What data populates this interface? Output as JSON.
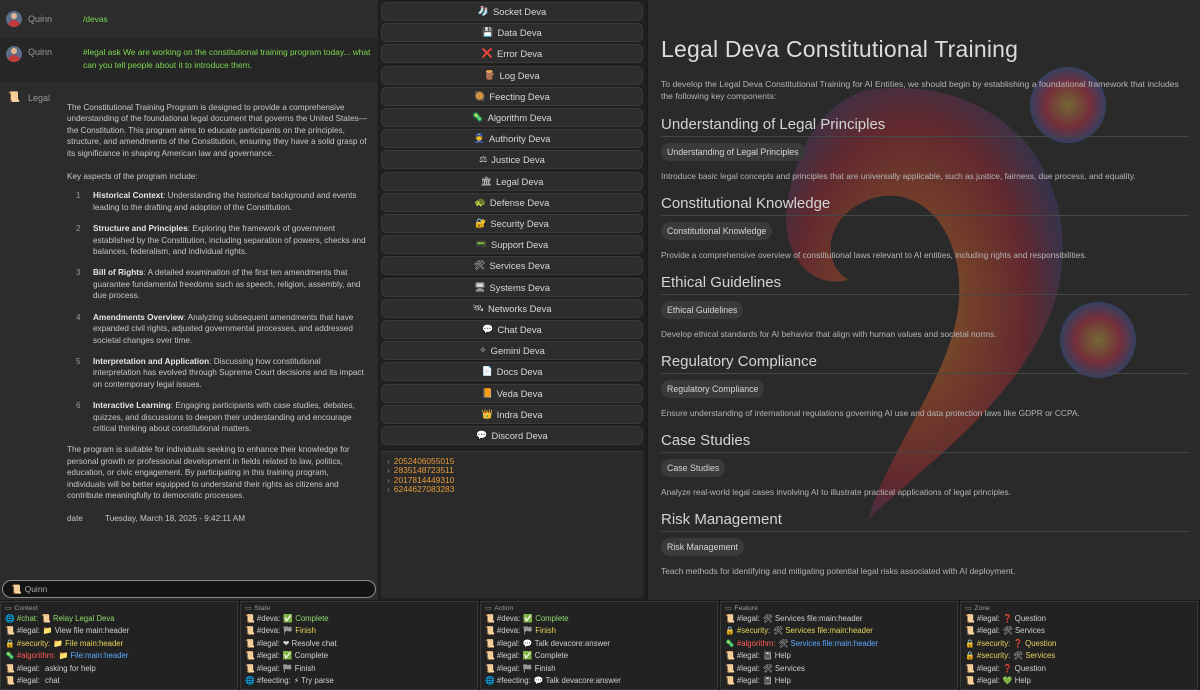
{
  "chat": {
    "messages": [
      {
        "sender": "Quinn",
        "text": "/devas"
      },
      {
        "sender": "Quinn",
        "text": "#legal ask We are working on the constitutional training program today... what can you tell people about it to introduce them."
      }
    ],
    "answer": {
      "sender": "Legal",
      "sender_icon": "legal-deva-icon",
      "intro": "The Constitutional Training Program is designed to provide a comprehensive understanding of the foundational legal document that governs the United States—the Constitution. This program aims to educate participants on the principles, structure, and amendments of the Constitution, ensuring they have a solid grasp of its significance in shaping American law and governance.",
      "aspects_heading": "Key aspects of the program include:",
      "aspects": [
        {
          "num": "1",
          "title": "Historical Context",
          "text": ": Understanding the historical background and events leading to the drafting and adoption of the Constitution."
        },
        {
          "num": "2",
          "title": "Structure and Principles",
          "text": ": Exploring the framework of government established by the Constitution, including separation of powers, checks and balances, federalism, and individual rights."
        },
        {
          "num": "3",
          "title": "Bill of Rights",
          "text": ": A detailed examination of the first ten amendments that guarantee fundamental freedoms such as speech, religion, assembly, and due process."
        },
        {
          "num": "4",
          "title": "Amendments Overview",
          "text": ": Analyzing subsequent amendments that have expanded civil rights, adjusted governmental processes, and addressed societal changes over time."
        },
        {
          "num": "5",
          "title": "Interpretation and Application",
          "text": ": Discussing how constitutional interpretation has evolved through Supreme Court decisions and its impact on contemporary legal issues."
        },
        {
          "num": "6",
          "title": "Interactive Learning",
          "text": ": Engaging participants with case studies, debates, quizzes, and discussions to deepen their understanding and encourage critical thinking about constitutional matters."
        }
      ],
      "closing": "The program is suitable for individuals seeking to enhance their knowledge for personal growth or professional development in fields related to law, politics, education, or civic engagement. By participating in this training program, individuals will be better equipped to understand their rights as citizens and contribute meaningfully to democratic processes.",
      "date_label": "date",
      "date_value": "Tuesday, March 18, 2025 - 9:42:11 AM"
    },
    "input": {
      "icon": "legal-scroll-icon",
      "placeholder": "Quinn"
    }
  },
  "devas": [
    {
      "icon": "🧦",
      "label": "Socket Deva"
    },
    {
      "icon": "💾",
      "label": "Data Deva"
    },
    {
      "icon": "❌",
      "label": "Error Deva"
    },
    {
      "icon": "🪵",
      "label": "Log Deva"
    },
    {
      "icon": "🥘",
      "label": "Feecting Deva"
    },
    {
      "icon": "🦠",
      "label": "Algorithm Deva"
    },
    {
      "icon": "👮",
      "label": "Authority Deva"
    },
    {
      "icon": "⚖",
      "label": "Justice Deva"
    },
    {
      "icon": "🏛",
      "label": "Legal Deva"
    },
    {
      "icon": "🐢",
      "label": "Defense Deva"
    },
    {
      "icon": "🔐",
      "label": "Security Deva"
    },
    {
      "icon": "📟",
      "label": "Support Deva"
    },
    {
      "icon": "🛠",
      "label": "Services Deva"
    },
    {
      "icon": "🖥",
      "label": "Systems Deva"
    },
    {
      "icon": "🛰",
      "label": "Networks Deva"
    },
    {
      "icon": "💬",
      "label": "Chat Deva"
    },
    {
      "icon": "✧",
      "label": "Gemini Deva"
    },
    {
      "icon": "📄",
      "label": "Docs Deva"
    },
    {
      "icon": "📙",
      "label": "Veda Deva"
    },
    {
      "icon": "👑",
      "label": "Indra Deva"
    },
    {
      "icon": "💬",
      "label": "Discord Deva"
    }
  ],
  "hashes": [
    "2052406055015",
    "2835148723511",
    "2017814449310",
    "6244627083283"
  ],
  "document": {
    "title": "Legal Deva Constitutional Training",
    "intro": "To develop the Legal Deva Constitutional Training for AI Entities, we should begin by establishing a foundational framework that includes the following key components:",
    "sections": [
      {
        "heading": "Understanding of Legal Principles",
        "tag": "Understanding of Legal Principles",
        "text": "Introduce basic legal concepts and principles that are universally applicable, such as justice, fairness, due process, and equality."
      },
      {
        "heading": "Constitutional Knowledge",
        "tag": "Constitutional Knowledge",
        "text": "Provide a comprehensive overview of constitutional laws relevant to AI entities, including rights and responsibilities."
      },
      {
        "heading": "Ethical Guidelines",
        "tag": "Ethical Guidelines",
        "text": "Develop ethical standards for AI behavior that align with human values and societal norms."
      },
      {
        "heading": "Regulatory Compliance",
        "tag": "Regulatory Compliance",
        "text": "Ensure understanding of international regulations governing AI use and data protection laws like GDPR or CCPA."
      },
      {
        "heading": "Case Studies",
        "tag": "Case Studies",
        "text": "Analyze real-world legal cases involving AI to illustrate practical applications of legal principles."
      },
      {
        "heading": "Risk Management",
        "tag": "Risk Management",
        "text": "Teach methods for identifying and mitigating potential legal risks associated with AI deployment."
      }
    ]
  },
  "panels": [
    {
      "title": "Context",
      "rows": [
        {
          "icon": "🌐",
          "tag": "#chat:",
          "tag_color": "green",
          "icon2": "📜",
          "text": "Relay Legal Deva",
          "text_color": "green"
        },
        {
          "icon": "📜",
          "tag": "#legal:",
          "tag_color": "default",
          "icon2": "📁",
          "text": "View file main:header",
          "text_color": "default"
        },
        {
          "icon": "🔒",
          "tag": "#security:",
          "tag_color": "yellow",
          "icon2": "📁",
          "text": "File main:header",
          "text_color": "yellow"
        },
        {
          "icon": "🦠",
          "tag": "#algorithm:",
          "tag_color": "red",
          "icon2": "📁",
          "text": "File:main:header",
          "text_color": "blue"
        },
        {
          "icon": "📜",
          "tag": "#legal:",
          "tag_color": "default",
          "icon2": "",
          "text": "asking for help",
          "text_color": "default"
        },
        {
          "icon": "📜",
          "tag": "#legal:",
          "tag_color": "default",
          "icon2": "",
          "text": "chat",
          "text_color": "default"
        }
      ]
    },
    {
      "title": "State",
      "rows": [
        {
          "icon": "📜",
          "tag": "#deva:",
          "tag_color": "default",
          "icon2": "✅",
          "text": "Complete",
          "text_color": "green"
        },
        {
          "icon": "📜",
          "tag": "#deva:",
          "tag_color": "default",
          "icon2": "🏁",
          "text": "Finish",
          "text_color": "yellow"
        },
        {
          "icon": "📜",
          "tag": "#legal:",
          "tag_color": "default",
          "icon2": "❤",
          "text": "Resolve chat",
          "text_color": "default"
        },
        {
          "icon": "📜",
          "tag": "#legal:",
          "tag_color": "default",
          "icon2": "✅",
          "text": "Complete",
          "text_color": "default"
        },
        {
          "icon": "📜",
          "tag": "#legal:",
          "tag_color": "default",
          "icon2": "🏁",
          "text": "Finish",
          "text_color": "default"
        },
        {
          "icon": "🌐",
          "tag": "#feecting:",
          "tag_color": "default",
          "icon2": "⚡",
          "text": "Try parse",
          "text_color": "default"
        }
      ]
    },
    {
      "title": "Action",
      "rows": [
        {
          "icon": "📜",
          "tag": "#deva:",
          "tag_color": "default",
          "icon2": "✅",
          "text": "Complete",
          "text_color": "green"
        },
        {
          "icon": "📜",
          "tag": "#deva:",
          "tag_color": "default",
          "icon2": "🏁",
          "text": "Finish",
          "text_color": "yellow"
        },
        {
          "icon": "📜",
          "tag": "#legal:",
          "tag_color": "default",
          "icon2": "💬",
          "text": "Talk devacore:answer",
          "text_color": "default"
        },
        {
          "icon": "📜",
          "tag": "#legal:",
          "tag_color": "default",
          "icon2": "✅",
          "text": "Complete",
          "text_color": "default"
        },
        {
          "icon": "📜",
          "tag": "#legal:",
          "tag_color": "default",
          "icon2": "🏁",
          "text": "Finish",
          "text_color": "default"
        },
        {
          "icon": "🌐",
          "tag": "#feecting:",
          "tag_color": "default",
          "icon2": "💬",
          "text": "Talk devacore:answer",
          "text_color": "default"
        }
      ]
    },
    {
      "title": "Feature",
      "rows": [
        {
          "icon": "📜",
          "tag": "#legal:",
          "tag_color": "default",
          "icon2": "🛠",
          "text": "Services file:main:header",
          "text_color": "default"
        },
        {
          "icon": "🔒",
          "tag": "#security:",
          "tag_color": "yellow",
          "icon2": "🛠",
          "text": "Services file:main:header",
          "text_color": "yellow"
        },
        {
          "icon": "🦠",
          "tag": "#algorithm:",
          "tag_color": "red",
          "icon2": "🛠",
          "text": "Services file:main:header",
          "text_color": "blue"
        },
        {
          "icon": "📜",
          "tag": "#legal:",
          "tag_color": "default",
          "icon2": "📓",
          "text": "Help",
          "text_color": "default"
        },
        {
          "icon": "📜",
          "tag": "#legal:",
          "tag_color": "default",
          "icon2": "🛠",
          "text": "Services",
          "text_color": "default"
        },
        {
          "icon": "📜",
          "tag": "#legal:",
          "tag_color": "default",
          "icon2": "📓",
          "text": "Help",
          "text_color": "default"
        }
      ]
    },
    {
      "title": "Zone",
      "rows": [
        {
          "icon": "📜",
          "tag": "#legal:",
          "tag_color": "default",
          "icon2": "❓",
          "text": "Question",
          "text_color": "default"
        },
        {
          "icon": "📜",
          "tag": "#legal:",
          "tag_color": "default",
          "icon2": "🛠",
          "text": "Services",
          "text_color": "default"
        },
        {
          "icon": "🔒",
          "tag": "#security:",
          "tag_color": "yellow",
          "icon2": "❓",
          "text": "Question",
          "text_color": "yellow"
        },
        {
          "icon": "🔒",
          "tag": "#security:",
          "tag_color": "yellow",
          "icon2": "🛠",
          "text": "Services",
          "text_color": "yellow"
        },
        {
          "icon": "📜",
          "tag": "#legal:",
          "tag_color": "default",
          "icon2": "❓",
          "text": "Question",
          "text_color": "default"
        },
        {
          "icon": "📜",
          "tag": "#legal:",
          "tag_color": "default",
          "icon2": "💚",
          "text": "Help",
          "text_color": "default"
        }
      ]
    }
  ]
}
